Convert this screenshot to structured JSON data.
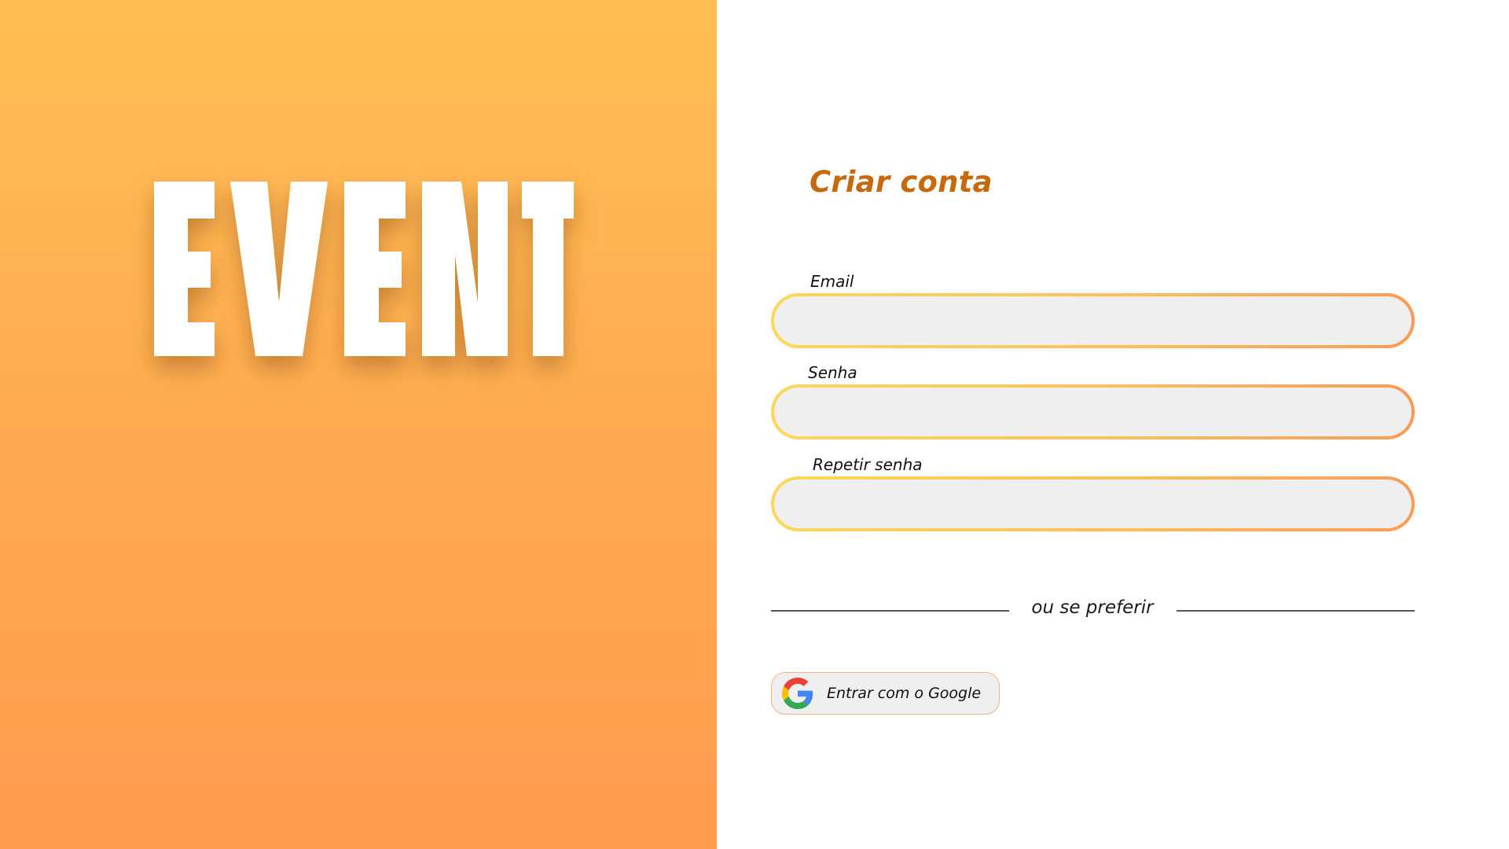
{
  "brand": {
    "logo_text": "EVENT",
    "panel_gradient": [
      "#ffbe55",
      "#ffab52",
      "#ff9b4e"
    ]
  },
  "form": {
    "title": "Criar conta",
    "title_color": "#c6680c",
    "fields": [
      {
        "label": "Email",
        "value": "",
        "type": "email"
      },
      {
        "label": "Senha",
        "value": "",
        "type": "password"
      },
      {
        "label": "Repetir senha",
        "value": "",
        "type": "password"
      }
    ],
    "field_border_gradient": [
      "#fbd85a",
      "#fcbf5a",
      "#fd9a55"
    ],
    "field_background": "#efefef"
  },
  "divider": {
    "text": "ou se preferir"
  },
  "google_button": {
    "label": "Entrar com o Google",
    "icon": "google-icon"
  }
}
